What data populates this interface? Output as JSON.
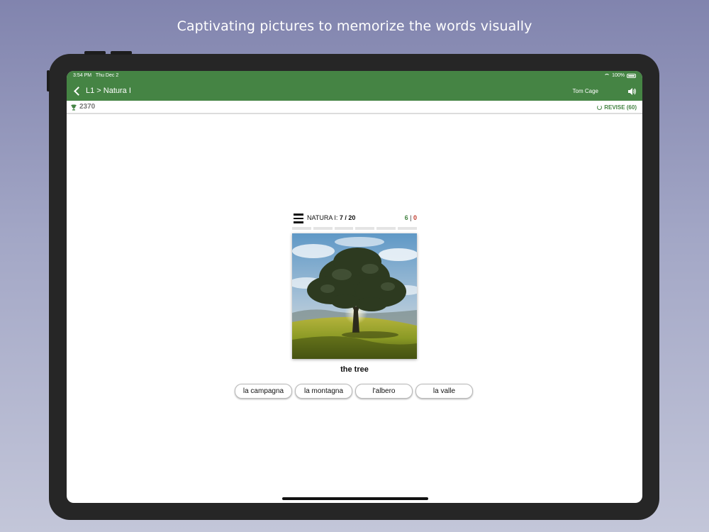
{
  "tagline": "Captivating pictures to memorize the words visually",
  "status_bar": {
    "time": "3:54 PM",
    "date": "Thu Dec 2",
    "battery": "100%",
    "wifi_icon": "wifi-icon",
    "battery_icon": "battery-icon"
  },
  "nav": {
    "back_icon": "chevron-left-icon",
    "title": "L1 > Natura I",
    "user": "Tom Cage",
    "sound_icon": "speaker-icon"
  },
  "score_bar": {
    "trophy_icon": "trophy-icon",
    "points": "2370",
    "revise_label": "REVISE (60)"
  },
  "quiz": {
    "lesson_prefix": "NATURA I: ",
    "progress_text": "7 / 20",
    "correct": "6",
    "separator": "|",
    "wrong": "0",
    "word": "the tree",
    "answers": [
      "la campagna",
      "la montagna",
      "l'albero",
      "la valle"
    ]
  },
  "colors": {
    "accent": "#458444",
    "background_top": "#8184ae",
    "background_bottom": "#c3c6d9",
    "wrong": "#c0392b"
  }
}
